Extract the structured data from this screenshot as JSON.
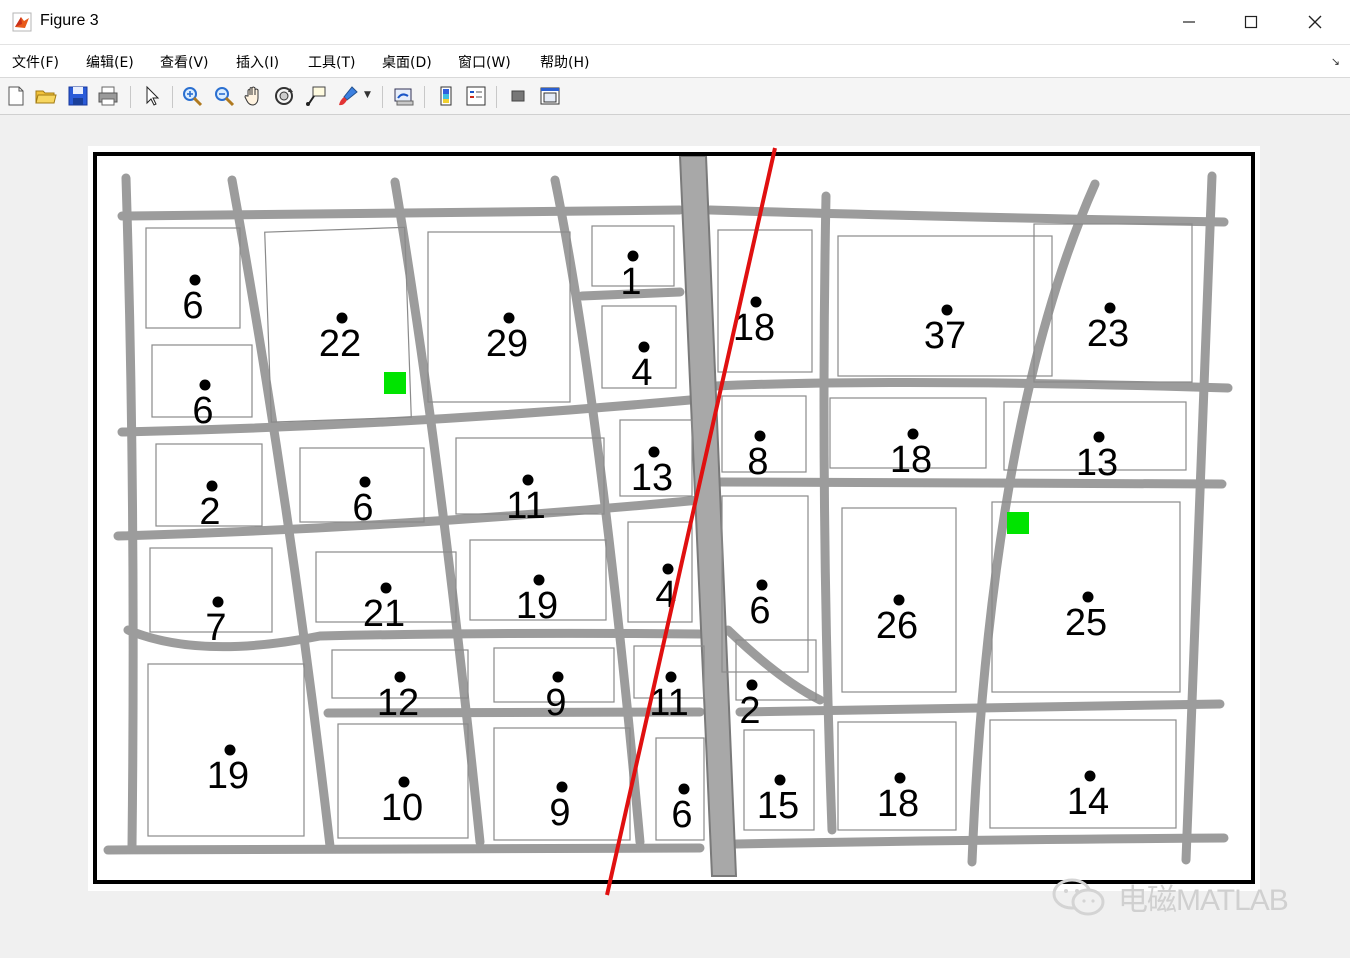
{
  "window": {
    "title": "Figure 3"
  },
  "menu": {
    "items": [
      "文件(F)",
      "编辑(E)",
      "查看(V)",
      "插入(I)",
      "工具(T)",
      "桌面(D)",
      "窗口(W)",
      "帮助(H)"
    ]
  },
  "toolbar": {
    "icons": [
      "new-figure-icon",
      "open-file-icon",
      "save-icon",
      "print-icon",
      "select-arrow-icon",
      "zoom-in-icon",
      "zoom-out-icon",
      "pan-hand-icon",
      "rotate-3d-icon",
      "data-cursor-icon",
      "brush-icon",
      "link-plot-icon",
      "colorbar-icon",
      "legend-icon",
      "hide-plot-tools-icon",
      "show-plot-tools-icon"
    ]
  },
  "map": {
    "block_labels": [
      "6",
      "22",
      "29",
      "1",
      "18",
      "37",
      "23",
      "6",
      "4",
      "2",
      "6",
      "11",
      "13",
      "8",
      "18",
      "13",
      "7",
      "21",
      "19",
      "4",
      "6",
      "26",
      "25",
      "12",
      "9",
      "11",
      "2",
      "19",
      "10",
      "9",
      "6",
      "15",
      "18",
      "14"
    ],
    "marker_color": "#00e400",
    "line_color": "#e01010"
  },
  "watermark": {
    "text": "电磁MATLAB"
  }
}
